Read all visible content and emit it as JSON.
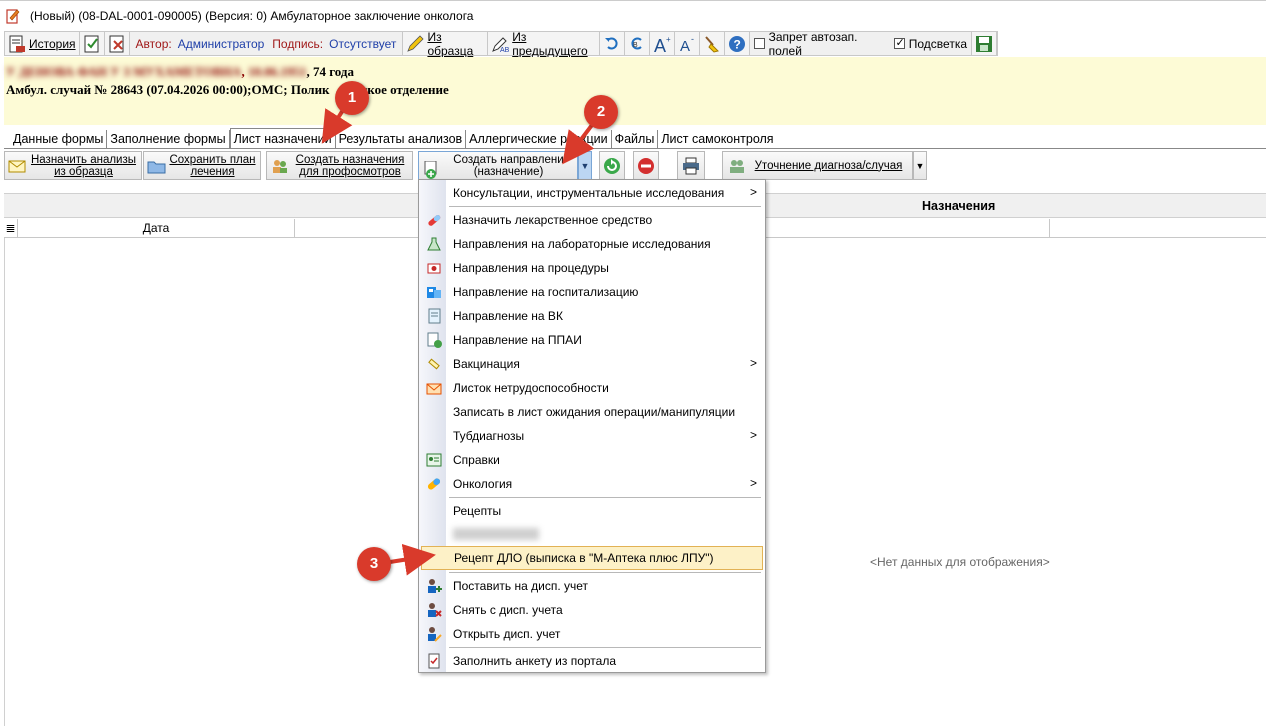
{
  "window": {
    "title": "(Новый) (08-DAL-0001-090005) (Версия: 0) Амбулаторное заключение онколога"
  },
  "toolbar1": {
    "history_label": "История",
    "author_label": "Автор:",
    "author_value": "Администратор",
    "signature_label": "Подпись:",
    "signature_value": "Отсутствует",
    "from_template_label": "Из образца",
    "from_previous_label": "Из предыдущего",
    "autofill_ban_label": "Запрет автозап. полей",
    "autofill_ban_checked": false,
    "highlight_label": "Подсветка",
    "highlight_checked": true
  },
  "patient": {
    "name_hidden": "У ДЕНОВА ФАН У З МУХАМЕТОВНА",
    "dob_hidden": "10.06.1951",
    "age": ", 74 года",
    "case_info": "Амбул. случай  № 28643 (07.04.2026 00:00);ОМС; Полик",
    "case_info_tail": "еское отделение"
  },
  "tabs": [
    {
      "label": "Данные формы"
    },
    {
      "label": "Заполнение формы"
    },
    {
      "label": "Лист назначений"
    },
    {
      "label": "Результаты анализов"
    },
    {
      "label": "Аллергические реакции"
    },
    {
      "label": "Файлы"
    },
    {
      "label": "Лист самоконтроля"
    }
  ],
  "toolbar2": {
    "assign_tests_line1": "Назначить анализы",
    "assign_tests_line2": "из образца",
    "save_plan_line1": "Сохранить план",
    "save_plan_line2": "лечения",
    "create_prof_line1": "Создать назначения",
    "create_prof_line2": "для профосмотров",
    "create_dir_line1": "Создать направлени",
    "create_dir_line2": "(назначение)",
    "clarify_diag": "Уточнение диагноза/случая"
  },
  "grid": {
    "group_header": "Назначения",
    "col_date": "Дата",
    "empty_text": "<Нет данных для отображения>"
  },
  "menu": {
    "items": [
      {
        "label": "Консультации, инструментальные исследования",
        "submenu": true
      },
      {
        "label": "Назначить лекарственное средство"
      },
      {
        "label": "Направления на лабораторные исследования"
      },
      {
        "label": "Направления на процедуры"
      },
      {
        "label": "Направление на госпитализацию"
      },
      {
        "label": "Направление на ВК"
      },
      {
        "label": "Направление на ППАИ"
      },
      {
        "label": "Вакцинация",
        "submenu": true
      },
      {
        "label": "Листок нетрудоспособности"
      },
      {
        "label": "Записать в лист ожидания операции/манипуляции"
      },
      {
        "label": "Тубдиагнозы",
        "submenu": true
      },
      {
        "label": "Справки"
      },
      {
        "label": "Онкология",
        "submenu": true
      },
      {
        "label": "Рецепты"
      },
      {
        "label": "Рецепт ДЛО (выписка в \"М-Аптека плюс ЛПУ\")"
      },
      {
        "label": "Поставить на дисп. учет"
      },
      {
        "label": "Снять с дисп. учета"
      },
      {
        "label": "Открыть дисп. учет"
      },
      {
        "label": "Заполнить анкету из портала"
      }
    ],
    "submenu_arrow": ">"
  },
  "annotations": {
    "badge1": "1",
    "badge2": "2",
    "badge3": "3"
  },
  "colors": {
    "annotation_red": "#d93a2b",
    "patient_bg": "#fdfbd6",
    "menu_highlight": "#fdf1c7"
  }
}
